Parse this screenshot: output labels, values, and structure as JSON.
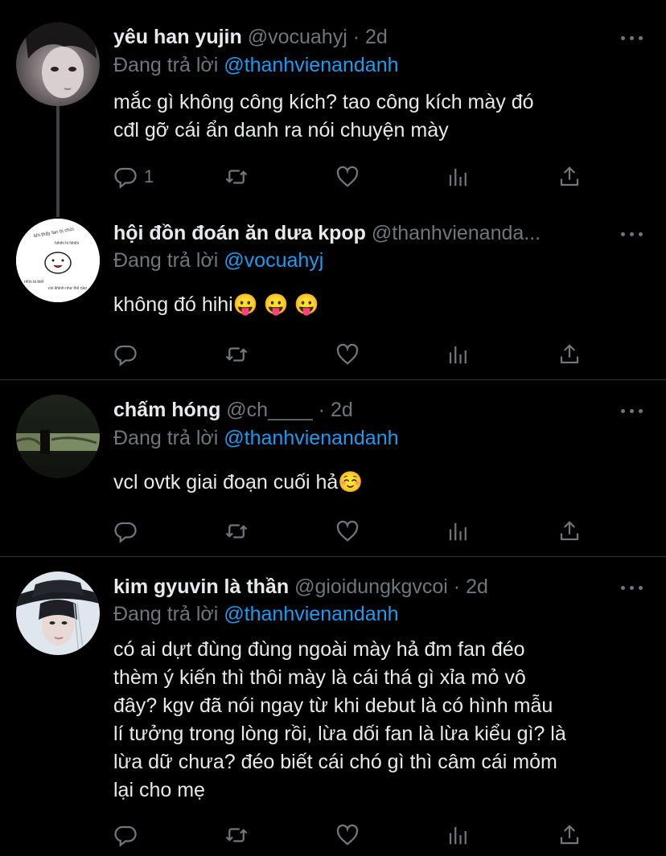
{
  "reply_prefix": "Đang trả lời",
  "tweets": [
    {
      "name": "yêu han yujin",
      "handle": "@vocuahyj",
      "time": "2d",
      "reply_to": "@thanhvienandanh",
      "text": "mắc gì không công kích? tao công kích mày đó\ncđl gỡ cái ẩn danh ra nói chuyện mày",
      "reply_count": "1"
    },
    {
      "name": "hội đồn đoán ăn dưa kpop",
      "handle": "@thanhvienanda...",
      "time": "",
      "reply_to": "@vocuahyj",
      "text": "không đó hihi😛 😛 😛",
      "reply_count": ""
    },
    {
      "name": "chấm hóng",
      "handle": "@ch____",
      "time": "2d",
      "reply_to": "@thanhvienandanh",
      "text": "vcl ovtk giai đoạn cuối hả☺️",
      "reply_count": ""
    },
    {
      "name": "kim gyuvin là thần",
      "handle": "@gioidungkgvcoi",
      "time": "2d",
      "reply_to": "@thanhvienandanh",
      "text": "có ai dựt đùng đùng ngoài mày hả đm fan đéo\nthèm ý kiến thì thôi mày là cái thá gì xỉa mỏ vô\nđây? kgv đã nói ngay từ khi debut là có hình mẫu\nlí tưởng trong lòng rồi, lừa dối fan là lừa kiểu gì? là\nlừa dữ chưa? đéo biết cái chó gì thì câm cái mỏm\nlại cho mẹ",
      "reply_count": ""
    }
  ],
  "icons": [
    "reply-icon",
    "retweet-icon",
    "like-icon",
    "analytics-icon",
    "share-icon",
    "more-icon"
  ],
  "colors": {
    "background": "#000000",
    "text": "#e7e9ea",
    "muted": "#71767b",
    "link": "#1d9bf0",
    "divider": "#2f3336"
  }
}
